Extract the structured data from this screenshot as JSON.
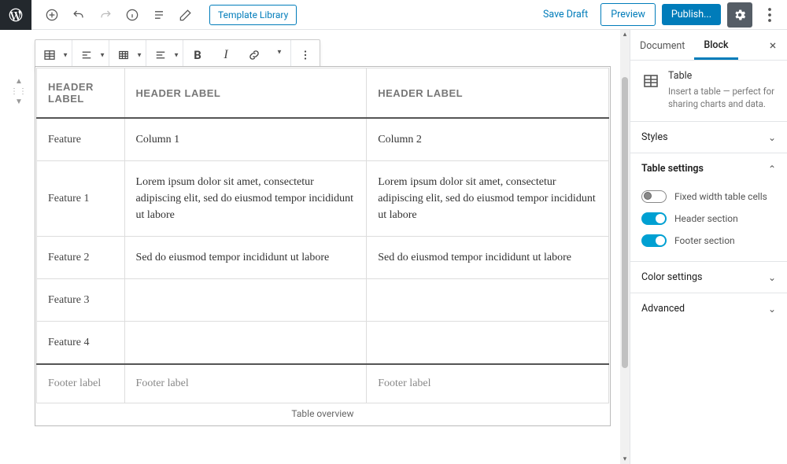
{
  "topbar": {
    "template_library": "Template Library",
    "save_draft": "Save Draft",
    "preview": "Preview",
    "publish": "Publish..."
  },
  "block_toolbar": {},
  "table": {
    "headers": [
      "HEADER LABEL",
      "HEADER LABEL",
      "HEADER LABEL"
    ],
    "rows": [
      {
        "label": "Feature",
        "c1": "Column 1",
        "c2": "Column 2"
      },
      {
        "label": "Feature 1",
        "c1": "Lorem ipsum dolor sit amet, consectetur adipiscing elit, sed do eiusmod tempor incididunt ut labore",
        "c2": "Lorem ipsum dolor sit amet, consectetur adipiscing elit, sed do eiusmod tempor incididunt ut labore"
      },
      {
        "label": "Feature 2",
        "c1": "Sed do eiusmod tempor incididunt ut labore",
        "c2": "Sed do eiusmod tempor incididunt ut labore"
      },
      {
        "label": "Feature 3",
        "c1": "",
        "c2": ""
      },
      {
        "label": "Feature 4",
        "c1": "",
        "c2": ""
      }
    ],
    "footers": [
      "Footer label",
      "Footer label",
      "Footer label"
    ],
    "caption": "Table overview"
  },
  "sidebar": {
    "tabs": {
      "document": "Document",
      "block": "Block"
    },
    "block_info": {
      "title": "Table",
      "desc": "Insert a table — perfect for sharing charts and data."
    },
    "panels": {
      "styles": "Styles",
      "table_settings": "Table settings",
      "color_settings": "Color settings",
      "advanced": "Advanced"
    },
    "toggles": {
      "fixed_width": "Fixed width table cells",
      "header_section": "Header section",
      "footer_section": "Footer section"
    }
  }
}
